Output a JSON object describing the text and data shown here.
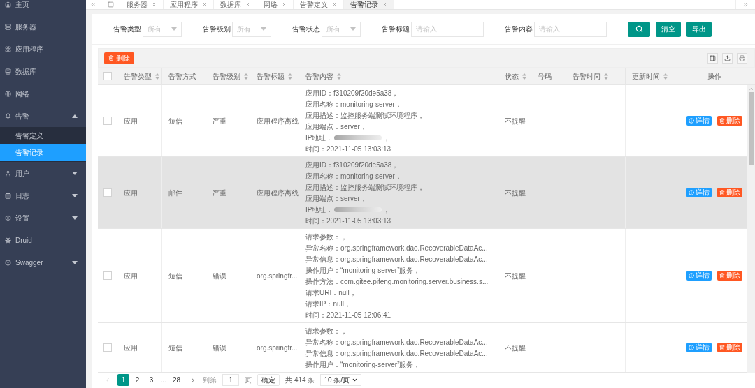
{
  "sidebar": {
    "items": [
      {
        "label": "主页",
        "selected": false
      },
      {
        "label": "服务器",
        "selected": false
      },
      {
        "label": "应用程序",
        "selected": false
      },
      {
        "label": "数据库",
        "selected": false
      },
      {
        "label": "网络",
        "selected": false
      },
      {
        "label": "告警",
        "selected": false,
        "expanded": true,
        "children": [
          {
            "label": "告警定义",
            "selected": false
          },
          {
            "label": "告警记录",
            "selected": true
          }
        ]
      },
      {
        "label": "用户",
        "selected": false,
        "expanded": false
      },
      {
        "label": "日志",
        "selected": false,
        "expanded": false
      },
      {
        "label": "设置",
        "selected": false,
        "expanded": false
      },
      {
        "label": "Druid",
        "selected": false
      },
      {
        "label": "Swagger",
        "selected": false,
        "expanded": false
      }
    ]
  },
  "tabs": [
    {
      "label": "服务器",
      "selected": false
    },
    {
      "label": "应用程序",
      "selected": false
    },
    {
      "label": "数据库",
      "selected": false
    },
    {
      "label": "网络",
      "selected": false
    },
    {
      "label": "告警定义",
      "selected": false
    },
    {
      "label": "告警记录",
      "selected": true
    }
  ],
  "filters": {
    "fields": [
      {
        "kind": "select",
        "label": "告警类型",
        "placeholder": "所有"
      },
      {
        "kind": "select",
        "label": "告警级别",
        "placeholder": "所有"
      },
      {
        "kind": "select",
        "label": "告警状态",
        "placeholder": "所有"
      },
      {
        "kind": "input",
        "label": "告警标题",
        "placeholder": "请输入"
      },
      {
        "kind": "input",
        "label": "告警内容",
        "placeholder": "请输入"
      }
    ],
    "buttons": [
      "清空",
      "导出"
    ]
  },
  "table": {
    "toolbar_button": "删除",
    "header_checked": false,
    "columns": [
      {
        "label": "告警类型",
        "sortable": true
      },
      {
        "label": "告警方式",
        "sortable": false
      },
      {
        "label": "告警级别",
        "sortable": true
      },
      {
        "label": "告警标题",
        "sortable": true
      },
      {
        "label": "告警内容",
        "sortable": true
      },
      {
        "label": "状态",
        "sortable": true
      },
      {
        "label": "号码",
        "sortable": false
      },
      {
        "label": "告警时间",
        "sortable": true
      },
      {
        "label": "更新时间",
        "sortable": true
      },
      {
        "label": "操作",
        "sortable": false
      }
    ],
    "rows": [
      {
        "checked": false,
        "highlighted": false,
        "cells": [
          "应用",
          "短信",
          "严重",
          "应用程序离线"
        ],
        "content": [
          {
            "kind": "text",
            "text": "应用ID：f310209f20de5a38，"
          },
          {
            "kind": "text",
            "text": "应用名称：monitoring-server，"
          },
          {
            "kind": "text",
            "text": "应用描述：监控服务端测试环境程序，"
          },
          {
            "kind": "text",
            "text": "应用端点：server，"
          },
          {
            "kind": "redacted",
            "text": "IP地址：",
            "suffix": "，"
          },
          {
            "kind": "text",
            "text": "时间：2021-11-05 13:03:13"
          }
        ],
        "status": "不提醒",
        "actions": [
          {
            "kind": "info",
            "label": "详情"
          },
          {
            "kind": "danger",
            "label": "删除"
          }
        ]
      },
      {
        "checked": false,
        "highlighted": true,
        "cells": [
          "应用",
          "邮件",
          "严重",
          "应用程序离线"
        ],
        "content": [
          {
            "kind": "text",
            "text": "应用ID：f310209f20de5a38，"
          },
          {
            "kind": "text",
            "text": "应用名称：monitoring-server，"
          },
          {
            "kind": "text",
            "text": "应用描述：监控服务端测试环境程序，"
          },
          {
            "kind": "text",
            "text": "应用端点：server，"
          },
          {
            "kind": "redacted",
            "text": "IP地址：",
            "suffix": "，"
          },
          {
            "kind": "text",
            "text": "时间：2021-11-05 13:03:13"
          }
        ],
        "status": "不提醒",
        "actions": [
          {
            "kind": "info",
            "label": "详情"
          },
          {
            "kind": "danger",
            "label": "删除"
          }
        ]
      },
      {
        "checked": false,
        "highlighted": false,
        "cells": [
          "应用",
          "短信",
          "错误",
          "org.springfr..."
        ],
        "content": [
          {
            "kind": "text",
            "text": "请求参数：，"
          },
          {
            "kind": "text",
            "text": "异常名称：org.springframework.dao.RecoverableDataAc..."
          },
          {
            "kind": "text",
            "text": "异常信息：org.springframework.dao.RecoverableDataAc..."
          },
          {
            "kind": "text",
            "text": "操作用户：“monitoring-server”服务，"
          },
          {
            "kind": "text",
            "text": "操作方法：com.gitee.pifeng.monitoring.server.business.s..."
          },
          {
            "kind": "text",
            "text": "请求URI：null，"
          },
          {
            "kind": "text",
            "text": "请求IP：null，"
          },
          {
            "kind": "text",
            "text": "时间：2021-11-05 12:06:41"
          }
        ],
        "status": "不提醒",
        "actions": [
          {
            "kind": "info",
            "label": "详情"
          },
          {
            "kind": "danger",
            "label": "删除"
          }
        ]
      },
      {
        "checked": false,
        "highlighted": false,
        "cells": [
          "应用",
          "短信",
          "错误",
          "org.springfr..."
        ],
        "content": [
          {
            "kind": "text",
            "text": "请求参数：，"
          },
          {
            "kind": "text",
            "text": "异常名称：org.springframework.dao.RecoverableDataAc..."
          },
          {
            "kind": "text",
            "text": "异常信息：org.springframework.dao.RecoverableDataAc..."
          },
          {
            "kind": "text",
            "text": "操作用户：“monitoring-server”服务，"
          }
        ],
        "status": "不提醒",
        "actions": [
          {
            "kind": "info",
            "label": "详情"
          },
          {
            "kind": "danger",
            "label": "删除"
          }
        ]
      }
    ]
  },
  "pagination": {
    "prev": {
      "disabled": true
    },
    "next": {
      "disabled": false
    },
    "pages": [
      {
        "kind": "page",
        "label": "1",
        "selected": true
      },
      {
        "kind": "page",
        "label": "2",
        "selected": false
      },
      {
        "kind": "page",
        "label": "3",
        "selected": false
      },
      {
        "kind": "ellipsis",
        "label": "…"
      },
      {
        "kind": "page",
        "label": "28",
        "selected": false
      }
    ],
    "jump_label": "到第",
    "jump_value": "1",
    "page_unit": "页",
    "confirm_button": "确定",
    "total": "共 414 条",
    "page_size": "10 条/页"
  }
}
